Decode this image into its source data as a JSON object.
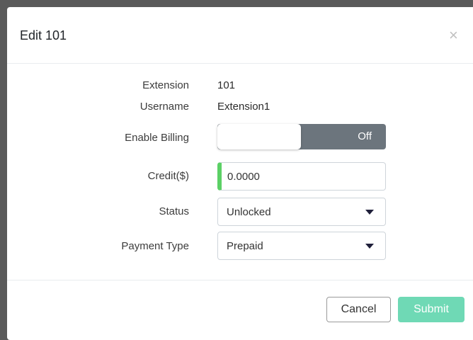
{
  "modal": {
    "title": "Edit 101",
    "close_symbol": "×"
  },
  "form": {
    "extension_label": "Extension",
    "extension_value": "101",
    "username_label": "Username",
    "username_value": "Extension1",
    "billing_label": "Enable Billing",
    "billing_state": "Off",
    "credit_label": "Credit($)",
    "credit_value": "0.0000",
    "status_label": "Status",
    "status_value": "Unlocked",
    "payment_label": "Payment Type",
    "payment_value": "Prepaid"
  },
  "footer": {
    "cancel_label": "Cancel",
    "submit_label": "Submit"
  },
  "colors": {
    "toggle_off": "#6c757d",
    "credit_accent": "#5bd065",
    "submit": "#6fd9b5",
    "backdrop": "#5a5a5a"
  },
  "icons": {
    "close": "close-icon",
    "dropdown": "caret-down-icon"
  }
}
